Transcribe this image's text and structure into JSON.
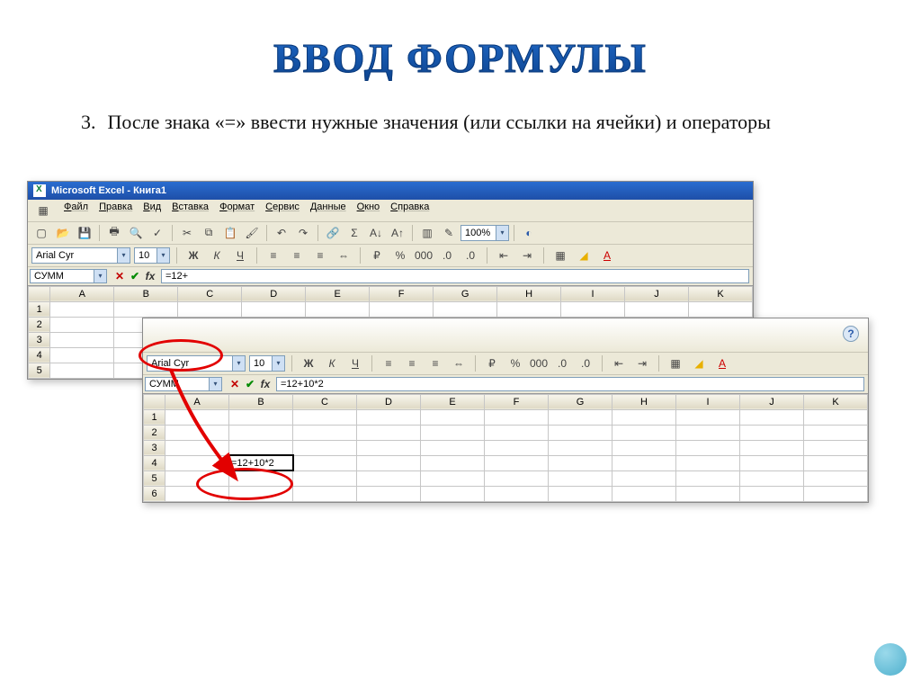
{
  "slide": {
    "title": "ВВОД ФОРМУЛЫ",
    "bullet_number": "3.",
    "bullet_text": "После знака «=» ввести нужные значения (или ссылки на ячейки) и операторы"
  },
  "excel1": {
    "title": "Microsoft Excel - Книга1",
    "menu": [
      "Файл",
      "Правка",
      "Вид",
      "Вставка",
      "Формат",
      "Сервис",
      "Данные",
      "Окно",
      "Справка"
    ],
    "font_name": "Arial Cyr",
    "font_size": "10",
    "zoom": "100%",
    "namebox": "СУММ",
    "formula": "=12+",
    "columns": [
      "A",
      "B",
      "C",
      "D",
      "E",
      "F",
      "G",
      "H",
      "I",
      "J",
      "K"
    ],
    "rows": [
      "1",
      "2",
      "3",
      "4",
      "5"
    ],
    "active_cell_value": "=12+",
    "format_buttons": {
      "bold": "Ж",
      "italic": "К",
      "underline": "Ч"
    }
  },
  "excel2": {
    "font_name": "Arial Cyr",
    "font_size": "10",
    "namebox": "СУММ",
    "formula": "=12+10*2",
    "columns": [
      "A",
      "B",
      "C",
      "D",
      "E",
      "F",
      "G",
      "H",
      "I",
      "J",
      "K"
    ],
    "rows": [
      "1",
      "2",
      "3",
      "4",
      "5",
      "6"
    ],
    "active_cell_value": "=12+10*2",
    "format_buttons": {
      "bold": "Ж",
      "italic": "К",
      "underline": "Ч"
    },
    "help": "?"
  }
}
